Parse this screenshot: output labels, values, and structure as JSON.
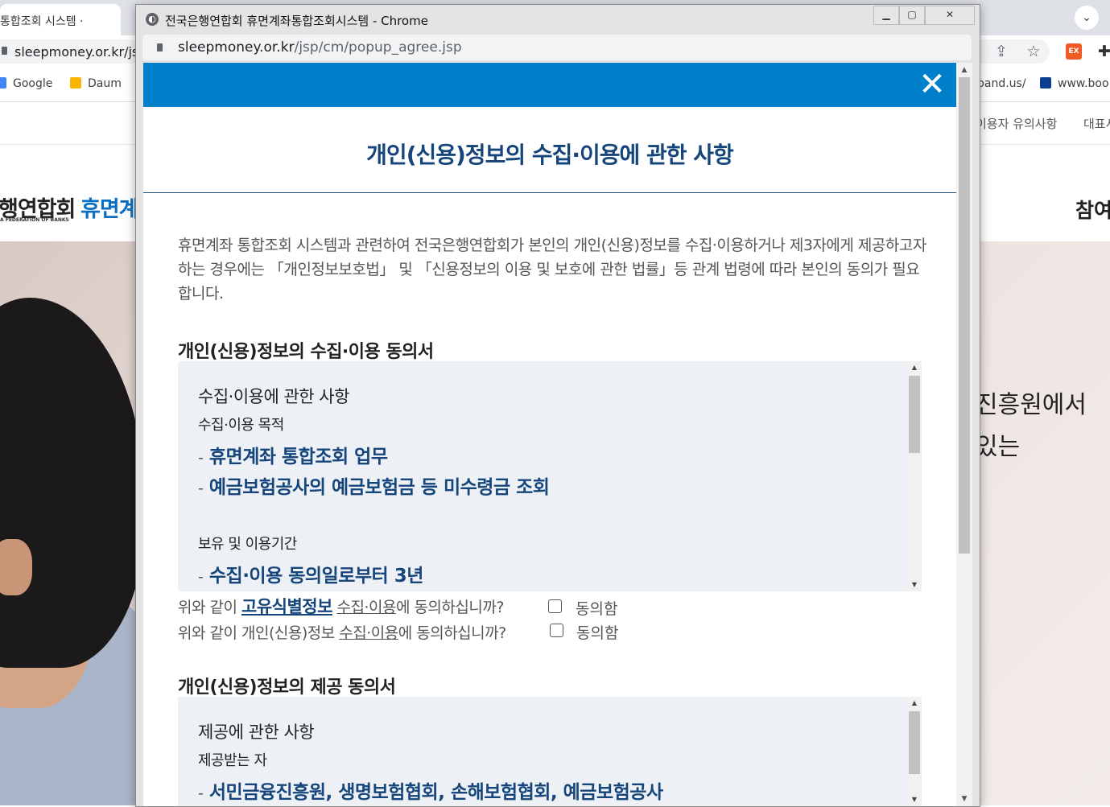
{
  "background_browser": {
    "tab_title": "통합조회 시스템 ·",
    "url": "sleepmoney.or.kr/js",
    "url_right": "",
    "bookmarks": [
      {
        "label": "Google",
        "color": "#4285f4"
      },
      {
        "label": "Daum",
        "color": "#f7b500"
      },
      {
        "label": "band.us/",
        "color": ""
      },
      {
        "label": "www.boo",
        "color": "#0b3d91"
      }
    ],
    "ex_badge": "EX",
    "nav_items": [
      "이용자 유의사항",
      "대표사"
    ],
    "logo_kr": "행연합회",
    "logo_blue": "휴면계",
    "logo_en": "A FEDERATION OF BANKS",
    "join_text": "참여",
    "hero_lines": [
      "진흥원에서",
      "있는"
    ]
  },
  "popup": {
    "window_title": "전국은행연합회 휴면계좌통합조회시스템 - Chrome",
    "url_domain": "sleepmoney.or.kr",
    "url_path": "/jsp/cm/popup_agree.jsp",
    "accent": "#0080cb",
    "title_color": "#15457b"
  },
  "document": {
    "title": "개인(신용)정보의 수집·이용에 관한 사항",
    "intro": "휴면계좌 통합조회 시스템과 관련하여 전국은행연합회가 본인의 개인(신용)정보를 수집·이용하거나 제3자에게 제공하고자 하는 경우에는 「개인정보보호법」 및 「신용정보의 이용 및 보호에 관한 법률」등 관계 법령에 따라 본인의 동의가 필요합니다.",
    "section1": {
      "title": "개인(신용)정보의 수집·이용 동의서",
      "box_heading": "수집·이용에 관한 사항",
      "purpose_label": "수집·이용 목적",
      "purpose_items": [
        "휴면계좌 통합조회 업무",
        "예금보험공사의 예금보험금 등 미수령금 조회"
      ],
      "period_label": "보유 및 이용기간",
      "period_items": [
        "수집·이용 동의일로부터 3년"
      ],
      "consent1": {
        "pre": "위와 같이 ",
        "link": "고유식별정보",
        "mid": " ",
        "ul": "수집·이용",
        "post": "에 동의하십니까?",
        "agree": "동의함",
        "checked": false
      },
      "consent2": {
        "pre": "위와 같이 개인(신용)정보 ",
        "ul": "수집·이용",
        "post": "에 동의하십니까?",
        "agree": "동의함",
        "checked": false
      }
    },
    "section2": {
      "title": "개인(신용)정보의 제공 동의서",
      "box_heading": "제공에 관한 사항",
      "recipient_label": "제공받는 자",
      "recipient_items": [
        "서민금융진흥원, 생명보험협회, 손해보험협회, 예금보험공사"
      ]
    },
    "dash": "-"
  }
}
